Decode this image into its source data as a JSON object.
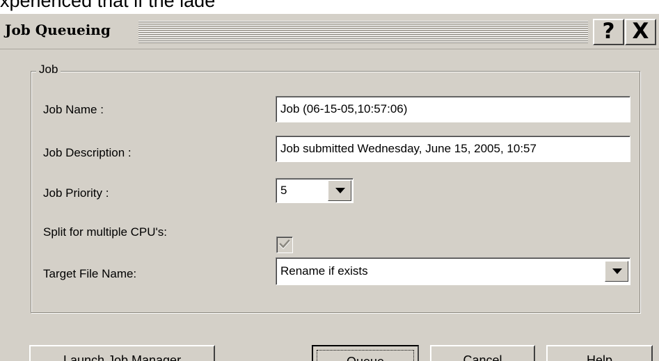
{
  "background_text": "xperienced that if the lade",
  "dialog": {
    "title": "Job Queueing",
    "help_button": "?",
    "close_button": "X"
  },
  "group": {
    "legend": "Job",
    "job_name": {
      "label": "Job Name :",
      "value": "Job (06-15-05,10:57:06)"
    },
    "job_description": {
      "label": "Job Description :",
      "value": "Job submitted Wednesday, June 15, 2005, 10:57"
    },
    "job_priority": {
      "label": "Job Priority :",
      "value": "5"
    },
    "split_cpu": {
      "label": "Split for multiple CPU's:",
      "checked": true,
      "enabled": false
    },
    "target_file": {
      "label": "Target File Name:",
      "value": "Rename if exists"
    }
  },
  "buttons": {
    "launch_job_manager": {
      "mnemonic": "L",
      "rest": "aunch Job Manager"
    },
    "queue": {
      "mnemonic": "Q",
      "rest": "ueue"
    },
    "cancel": "Cancel",
    "help": "Help"
  }
}
